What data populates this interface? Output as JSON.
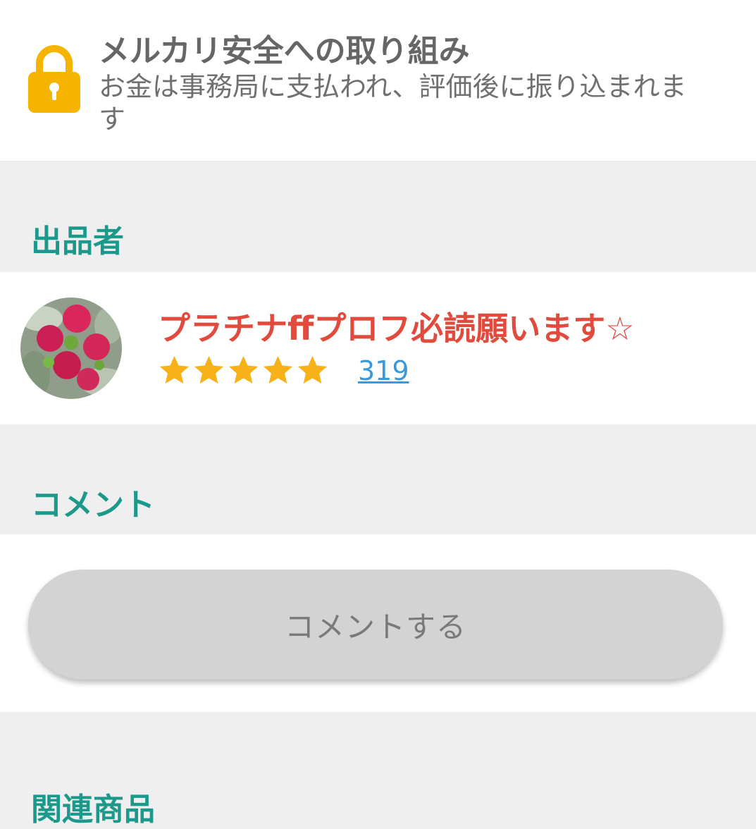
{
  "safety": {
    "title": "メルカリ安全への取り組み",
    "description": "お金は事務局に支払われ、評価後に振り込まれます",
    "icon": "lock-icon",
    "icon_color": "#f5b400"
  },
  "seller_section": {
    "heading": "出品者",
    "name": "プラチナffプロフ必読願います☆",
    "rating_stars": 5,
    "rating_max": 5,
    "rating_count": "319"
  },
  "comment_section": {
    "heading": "コメント",
    "button_label": "コメントする"
  },
  "related_section": {
    "heading": "関連商品"
  },
  "colors": {
    "accent": "#1b998b",
    "seller_name": "#e04b3d",
    "star": "#f7b21a",
    "link": "#3a9ad9"
  }
}
